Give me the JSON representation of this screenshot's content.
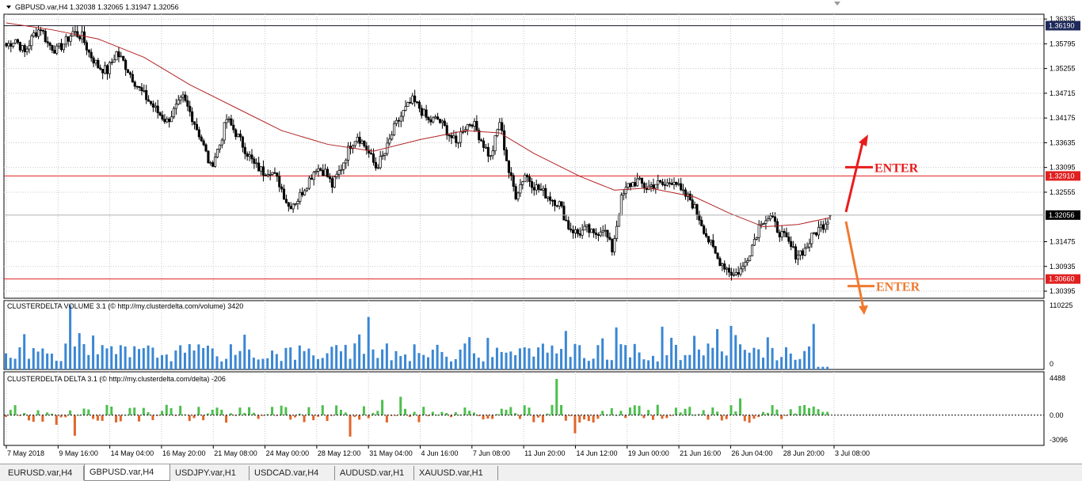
{
  "colors": {
    "bullish_volume": "#3a87d4",
    "delta_positive": "#4cbf4c",
    "delta_negative": "#e0662a",
    "moving_average": "#b22222",
    "level_line": "#e02020",
    "arrow_up": "#e81c1c",
    "arrow_down": "#f07a30"
  },
  "main_panel": {
    "title": "GBPUSD.var,H4  1.32038 1.32065 1.31947 1.32056",
    "collapse_icon": "triangle-down-icon",
    "price_labels": [
      "1.36335",
      "1.35795",
      "1.35255",
      "1.34715",
      "1.34175",
      "1.33635",
      "1.33095",
      "1.32555",
      "1.31475",
      "1.30935",
      "1.30395"
    ],
    "current_price": "1.32056",
    "levels": [
      {
        "price_text": "1.36190",
        "value": 1.3619,
        "style": "dark"
      },
      {
        "price_text": "1.32910",
        "value": 1.3291,
        "style": "red"
      },
      {
        "price_text": "1.30660",
        "value": 1.3066,
        "style": "red"
      }
    ],
    "annotations": [
      {
        "text": "ENTER",
        "direction": "up"
      },
      {
        "text": "ENTER",
        "direction": "down"
      }
    ]
  },
  "volume_panel": {
    "title": "CLUSTERDELTA VOLUME 3.1 (© http://my.clusterdelta.com/volume) 3420",
    "scale_max": "110225",
    "scale_min": "0"
  },
  "delta_panel": {
    "title": "CLUSTERDELTA DELTA 3.1 (© http://my.clusterdelta.com/delta) -206",
    "scale_top": "4488",
    "scale_zero": "0.00",
    "scale_bottom": "-3096"
  },
  "time_axis": [
    "7 May 2018",
    "9 May 16:00",
    "14 May 04:00",
    "16 May 20:00",
    "21 May 08:00",
    "24 May 00:00",
    "28 May 12:00",
    "31 May 04:00",
    "4 Jun 16:00",
    "7 Jun 08:00",
    "11 Jun 20:00",
    "14 Jun 12:00",
    "19 Jun 00:00",
    "21 Jun 16:00",
    "26 Jun 04:00",
    "28 Jun 20:00",
    "3 Jul 08:00"
  ],
  "tabs": [
    "EURUSD.var,H4",
    "GBPUSD.var,H4",
    "USDJPY.var,H1",
    "USDCAD.var,H4",
    "AUDUSD.var,H1",
    "XAUUSD.var,H1"
  ],
  "active_tab": "GBPUSD.var,H4",
  "chart_data": {
    "type": "candlestick",
    "symbol": "GBPUSD.var,H4",
    "y_range": [
      1.3024,
      1.3644
    ],
    "ohlc_last": {
      "open": 1.32038,
      "high": 1.32065,
      "low": 1.31947,
      "close": 1.32056
    },
    "close_path": [
      [
        0,
        1.3575
      ],
      [
        4,
        1.359
      ],
      [
        8,
        1.356
      ],
      [
        12,
        1.36
      ],
      [
        15,
        1.3615
      ],
      [
        18,
        1.358
      ],
      [
        22,
        1.3565
      ],
      [
        26,
        1.3585
      ],
      [
        29,
        1.3605
      ],
      [
        33,
        1.3595
      ],
      [
        36,
        1.356
      ],
      [
        40,
        1.353
      ],
      [
        44,
        1.352
      ],
      [
        48,
        1.356
      ],
      [
        51,
        1.354
      ],
      [
        55,
        1.3505
      ],
      [
        58,
        1.348
      ],
      [
        62,
        1.3455
      ],
      [
        66,
        1.343
      ],
      [
        70,
        1.341
      ],
      [
        74,
        1.344
      ],
      [
        77,
        1.346
      ],
      [
        81,
        1.342
      ],
      [
        85,
        1.337
      ],
      [
        89,
        1.331
      ],
      [
        93,
        1.336
      ],
      [
        96,
        1.3415
      ],
      [
        100,
        1.3385
      ],
      [
        104,
        1.335
      ],
      [
        108,
        1.3315
      ],
      [
        112,
        1.33
      ],
      [
        115,
        1.3305
      ],
      [
        119,
        1.3275
      ],
      [
        123,
        1.3225
      ],
      [
        127,
        1.324
      ],
      [
        131,
        1.3275
      ],
      [
        135,
        1.331
      ],
      [
        139,
        1.33
      ],
      [
        142,
        1.327
      ],
      [
        146,
        1.331
      ],
      [
        150,
        1.336
      ],
      [
        153,
        1.338
      ],
      [
        157,
        1.335
      ],
      [
        161,
        1.331
      ],
      [
        165,
        1.334
      ],
      [
        169,
        1.3395
      ],
      [
        173,
        1.343
      ],
      [
        177,
        1.3455
      ],
      [
        180,
        1.344
      ],
      [
        184,
        1.341
      ],
      [
        188,
        1.3415
      ],
      [
        192,
        1.339
      ],
      [
        196,
        1.336
      ],
      [
        199,
        1.3395
      ],
      [
        203,
        1.341
      ],
      [
        207,
        1.337
      ],
      [
        211,
        1.333
      ],
      [
        215,
        1.341
      ],
      [
        219,
        1.33
      ],
      [
        222,
        1.325
      ],
      [
        226,
        1.3295
      ],
      [
        230,
        1.327
      ],
      [
        234,
        1.3255
      ],
      [
        238,
        1.324
      ],
      [
        241,
        1.323
      ],
      [
        245,
        1.318
      ],
      [
        249,
        1.3165
      ],
      [
        253,
        1.3175
      ],
      [
        256,
        1.316
      ],
      [
        260,
        1.318
      ],
      [
        264,
        1.313
      ],
      [
        268,
        1.324
      ],
      [
        271,
        1.327
      ],
      [
        275,
        1.328
      ],
      [
        279,
        1.3265
      ],
      [
        283,
        1.3275
      ],
      [
        287,
        1.327
      ],
      [
        291,
        1.3285
      ],
      [
        294,
        1.3255
      ],
      [
        298,
        1.324
      ],
      [
        302,
        1.32
      ],
      [
        306,
        1.315
      ],
      [
        310,
        1.311
      ],
      [
        314,
        1.309
      ],
      [
        317,
        1.3075
      ],
      [
        321,
        1.309
      ],
      [
        325,
        1.314
      ],
      [
        329,
        1.3195
      ],
      [
        333,
        1.32
      ],
      [
        336,
        1.3175
      ],
      [
        340,
        1.315
      ],
      [
        344,
        1.312
      ],
      [
        348,
        1.313
      ],
      [
        352,
        1.3165
      ],
      [
        356,
        1.3185
      ],
      [
        359,
        1.3205
      ]
    ],
    "moving_average": [
      [
        0,
        1.3625
      ],
      [
        20,
        1.361
      ],
      [
        40,
        1.359
      ],
      [
        60,
        1.355
      ],
      [
        80,
        1.349
      ],
      [
        100,
        1.344
      ],
      [
        120,
        1.339
      ],
      [
        140,
        1.336
      ],
      [
        160,
        1.3345
      ],
      [
        180,
        1.337
      ],
      [
        200,
        1.339
      ],
      [
        215,
        1.3385
      ],
      [
        230,
        1.334
      ],
      [
        250,
        1.329
      ],
      [
        265,
        1.326
      ],
      [
        280,
        1.3265
      ],
      [
        300,
        1.3245
      ],
      [
        315,
        1.321
      ],
      [
        330,
        1.318
      ],
      [
        345,
        1.3185
      ],
      [
        359,
        1.32
      ]
    ],
    "volume_range": [
      0,
      110225
    ],
    "delta_range": [
      -3096,
      4488
    ]
  }
}
